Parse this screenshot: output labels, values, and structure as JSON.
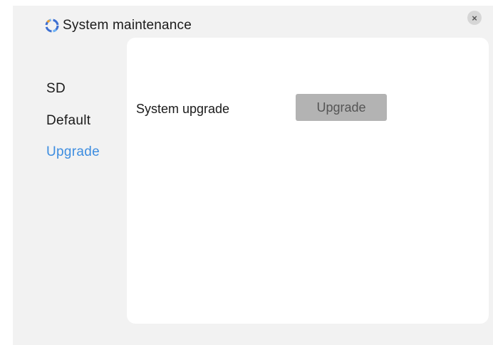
{
  "window": {
    "title": "System maintenance",
    "icon": "refresh-cycle-icon",
    "close_glyph": "×"
  },
  "sidebar": {
    "items": [
      {
        "label": "SD",
        "active": false
      },
      {
        "label": "Default",
        "active": false
      },
      {
        "label": "Upgrade",
        "active": true
      }
    ]
  },
  "panel": {
    "upgrade_row": {
      "label": "System upgrade",
      "button_label": "Upgrade"
    }
  },
  "colors": {
    "active_nav": "#3d8de0",
    "button_bg": "#b3b3b3",
    "dialog_bg": "#f2f2f2",
    "panel_bg": "#ffffff"
  }
}
